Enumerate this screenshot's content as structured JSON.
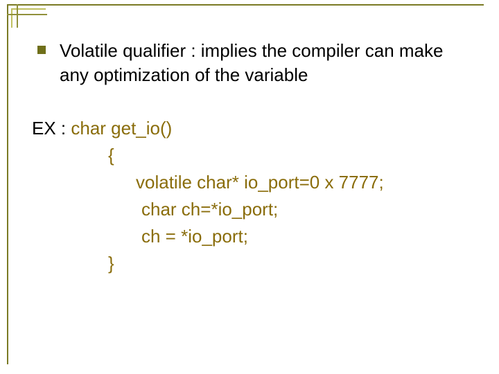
{
  "bullet": {
    "text": "Volatile qualifier : implies the compiler can make any optimization of the variable"
  },
  "example": {
    "prefix": "EX : ",
    "sig": "char get_io()",
    "open": "{",
    "l1": "volatile char* io_port=0 x 7777;",
    "l2": "char ch=*io_port;",
    "l3": "ch = *io_port;",
    "close": "}"
  }
}
